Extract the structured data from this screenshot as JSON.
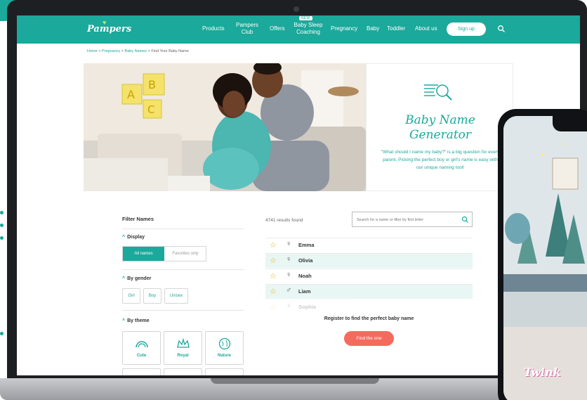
{
  "nav": {
    "logo": "Pampers",
    "items": [
      {
        "label": "Products"
      },
      {
        "label": "Pampers\nClub"
      },
      {
        "label": "Offers"
      },
      {
        "label": "Baby Sleep\nCoaching"
      },
      {
        "label": "Pregnancy"
      },
      {
        "label": "Baby"
      },
      {
        "label": "Toddler"
      },
      {
        "label": "About us"
      }
    ],
    "new_badge": "NEW",
    "signup_label": "Sign up",
    "search_icon": "search-icon"
  },
  "breadcrumb": {
    "home": "Home",
    "pregnancy": "Pregnancy",
    "baby_names": "Baby Names",
    "current": "Find Your Baby Name",
    "sep": ">"
  },
  "hero": {
    "title_line1": "Baby Name",
    "title_line2": "Generator",
    "description": "\"What should I name my baby?\" is a big question for every parent. Picking the perfect boy or girl's name is easy with our unique naming tool!"
  },
  "filters": {
    "title": "Filter Names",
    "display_label": "Display",
    "display_options": [
      "All names",
      "Favorites only"
    ],
    "gender_label": "By gender",
    "gender_options": [
      "Girl",
      "Boy",
      "Unisex"
    ],
    "theme_label": "By theme",
    "themes": [
      "Cute",
      "Royal",
      "Nature"
    ]
  },
  "results": {
    "count_text": "4741 results found",
    "search_placeholder": "Search for a name or filter by first letter",
    "names": [
      {
        "name": "Emma",
        "gender": "♀"
      },
      {
        "name": "Olivia",
        "gender": "♀"
      },
      {
        "name": "Noah",
        "gender": "♀"
      },
      {
        "name": "Liam",
        "gender": "♂"
      },
      {
        "name": "Sophia",
        "gender": "♀"
      }
    ],
    "register_text": "Register to find the perfect baby name",
    "find_button": "Find the one"
  },
  "phone": {
    "caption": "Twink"
  },
  "colors": {
    "brand_teal": "#1aa99a",
    "accent_coral": "#f46b5e",
    "star_yellow": "#e8b400"
  }
}
